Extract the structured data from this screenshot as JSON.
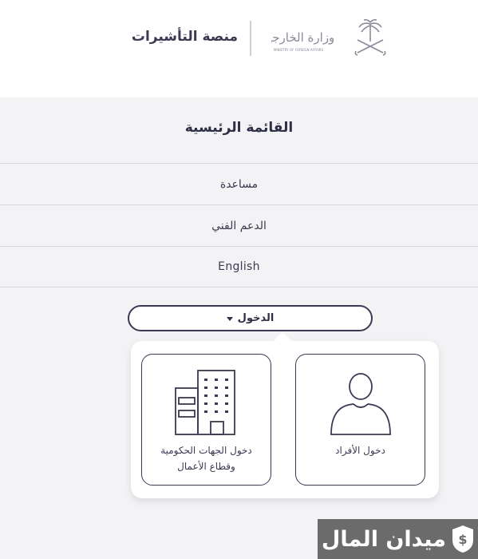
{
  "header": {
    "logo_text_ar": "وزارة الخارجية",
    "logo_text_en": "MINISTRY OF FOREIGN AFFAIRS",
    "platform_name": "منصة التأشيرات"
  },
  "menu": {
    "title": "القائمة الرئيسية",
    "items": [
      {
        "label": "مساعدة"
      },
      {
        "label": "الدعم الفني"
      },
      {
        "label": "English"
      }
    ]
  },
  "login": {
    "button_label": "الدخول",
    "options": [
      {
        "label": "دخول الأفراد",
        "icon": "person-icon"
      },
      {
        "label_line1": "دخول الجهات الحكومية",
        "label_line2": "وقطاع الأعمال",
        "icon": "building-icon"
      }
    ]
  },
  "watermark": {
    "text": "ميدان المال"
  },
  "colors": {
    "primary": "#3a3a52",
    "background": "#f3f3f5",
    "card_bg": "#ffffff",
    "emblem": "#8a8a9a",
    "watermark_bg": "#6b6b6b"
  }
}
